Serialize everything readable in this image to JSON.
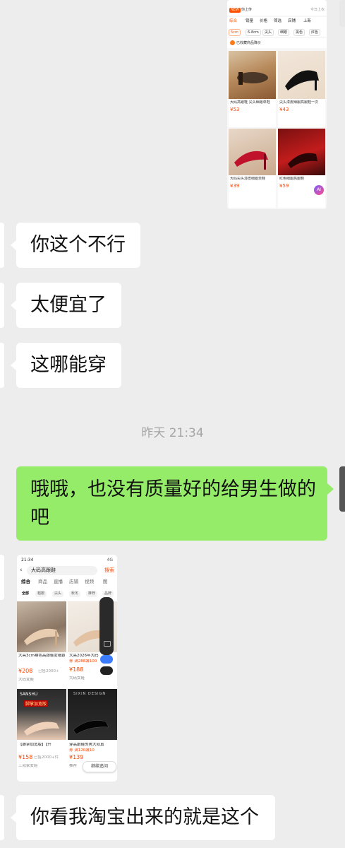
{
  "messages": [
    {
      "id": 1,
      "side": "in",
      "text": "你这个不行"
    },
    {
      "id": 2,
      "side": "in",
      "text": "太便宜了"
    },
    {
      "id": 3,
      "side": "in",
      "text": "这哪能穿"
    },
    {
      "id": 4,
      "side": "out",
      "text": "哦哦，也没有质量好的给男生做的吧"
    },
    {
      "id": 5,
      "side": "in",
      "text": "你看我淘宝出来的就是这个"
    }
  ],
  "timestamp": "昨天 21:34",
  "shot1": {
    "tag": "NEW",
    "bar_text": "你上传",
    "bar_right": "今日上衣",
    "filters": [
      "综合",
      "销量",
      "价格",
      "筛选",
      "店铺",
      "上新"
    ],
    "chips": [
      "5cm",
      "6-8cm",
      "尖头",
      "细跟",
      "黑色",
      "红色"
    ],
    "banner": "已收藏商品降价",
    "cards": [
      {
        "title": "大码高跟鞋 尖头细跟单鞋",
        "price": "¥53"
      },
      {
        "title": "尖头漆皮细跟高跟鞋一次",
        "price": "¥43"
      },
      {
        "title": "大码尖头漆皮细跟单鞋",
        "price": "¥39"
      },
      {
        "title": "红色细跟高跟鞋",
        "price": "¥59"
      }
    ],
    "ai_label": "AI"
  },
  "shot2": {
    "time": "21:34",
    "status_right": "4G",
    "search_text": "大码高跟鞋",
    "search_button": "搜索",
    "tabs": [
      "综合",
      "商品",
      "直播",
      "店铺",
      "视频",
      "图"
    ],
    "chips": [
      "全部",
      "粗跟",
      "尖头",
      "秋冬",
      "推荐",
      "品牌"
    ],
    "cards": [
      {
        "title": "大亮3cm裸色高跟鞋女细跟新款尖头百",
        "price": "¥208",
        "sold": "已售2000+",
        "shop": "大码女鞋"
      },
      {
        "title": "大亮2026年大码",
        "price": "¥188",
        "sold": "券 满288减100",
        "shop": "大码女鞋"
      },
      {
        "title": "【脚掌加宽版】【升",
        "price": "¥158",
        "sold": "已售2000+件",
        "shop": "三叔家女鞋"
      },
      {
        "title": "穿高跟鞋的男大叔真",
        "price": "¥139",
        "sold": "券 满120减10",
        "shop": "推荐"
      }
    ],
    "banner_labels": [
      "SANSHU",
      "脚掌加宽版",
      "SIXIN DESIGN"
    ],
    "continue_label": "继续追问"
  }
}
